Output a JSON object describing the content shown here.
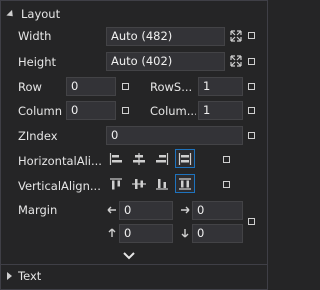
{
  "layout_section": {
    "title": "Layout"
  },
  "text_section": {
    "title": "Text"
  },
  "properties": {
    "width": {
      "label": "Width",
      "value": "Auto (482)"
    },
    "height": {
      "label": "Height",
      "value": "Auto (402)"
    },
    "row": {
      "label": "Row",
      "value": "0"
    },
    "row_span": {
      "label": "RowS...",
      "value": "1"
    },
    "column": {
      "label": "Column",
      "value": "0"
    },
    "column_span": {
      "label": "Colum...",
      "value": "1"
    },
    "zindex": {
      "label": "ZIndex",
      "value": "0"
    },
    "horizontal_alignment": {
      "label": "HorizontalAli...",
      "selected": "stretch"
    },
    "vertical_alignment": {
      "label": "VerticalAlign...",
      "selected": "stretch"
    },
    "margin": {
      "label": "Margin",
      "left": "0",
      "right": "0",
      "top": "0",
      "bottom": "0"
    }
  },
  "colors": {
    "background": "#252526",
    "field": "#333337",
    "field_border": "#434346",
    "selected_border": "#1e73be",
    "text": "#e6e6e6"
  },
  "icons": {
    "auto_size": "resize-arrows-icon",
    "property_marker": "square-marker-icon",
    "expand_more": "chevron-down-icon",
    "margin_left": "arrow-left-icon",
    "margin_right": "arrow-right-icon",
    "margin_top": "arrow-up-icon",
    "margin_bottom": "arrow-down-icon"
  }
}
